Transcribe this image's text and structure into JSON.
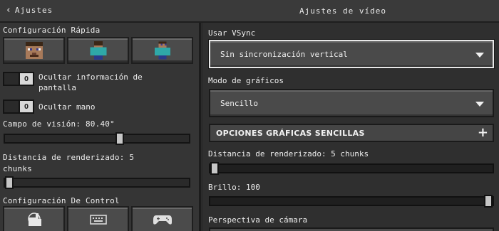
{
  "header": {
    "back_label": "Ajustes",
    "title": "Ajustes de vídeo"
  },
  "left": {
    "quick_config_label": "Configuración Rápida",
    "quick_buttons": [
      {
        "icon": "steve-face-icon"
      },
      {
        "icon": "player-body-icon"
      },
      {
        "icon": "player-full-icon"
      }
    ],
    "hide_hud": {
      "label_line1": "Ocultar información de",
      "label_line2": "pantalla",
      "toggle_knob": "O",
      "on": false
    },
    "hide_hand": {
      "label": "Ocultar mano",
      "toggle_knob": "O",
      "on": false
    },
    "fov": {
      "label": "Campo de visión: 80.40°",
      "min": 30,
      "max": 110,
      "value": 80.4
    },
    "render_distance": {
      "label_line1": "Distancia de renderizado: 5",
      "label_line2": "chunks",
      "min": 5,
      "max": 96,
      "value": 5
    },
    "control_config_label": "Configuración De Control",
    "control_buttons": [
      {
        "icon": "touch-hand-icon"
      },
      {
        "icon": "keyboard-icon"
      },
      {
        "icon": "gamepad-icon"
      }
    ]
  },
  "right": {
    "vsync": {
      "label": "Usar VSync",
      "value": "Sin sincronización vertical"
    },
    "graphics_mode": {
      "label": "Modo de gráficos",
      "value": "Sencillo"
    },
    "simple_options_header": "OPCIONES GRÁFICAS SENCILLAS",
    "render_distance": {
      "label": "Distancia de renderizado: 5 chunks",
      "min": 5,
      "max": 96,
      "value": 5
    },
    "brightness": {
      "label": "Brillo: 100",
      "min": 0,
      "max": 100,
      "value": 100
    },
    "camera_perspective": {
      "label": "Perspectiva de cámara"
    }
  }
}
